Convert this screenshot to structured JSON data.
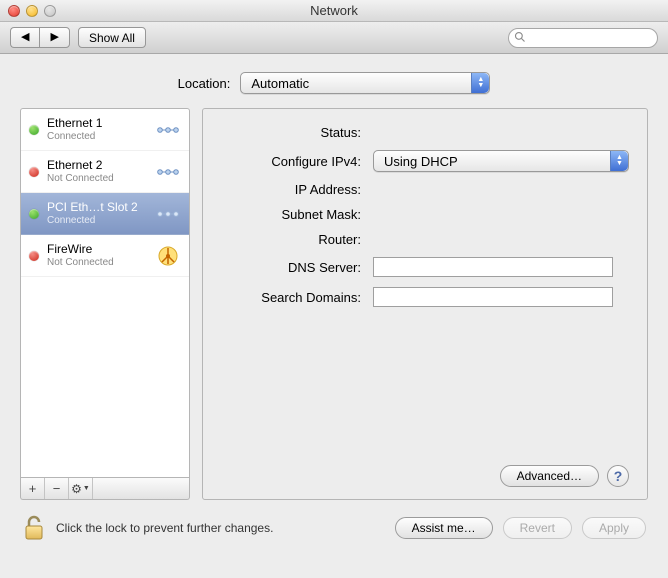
{
  "window": {
    "title": "Network"
  },
  "toolbar": {
    "show_all": "Show All",
    "search_placeholder": ""
  },
  "location": {
    "label": "Location:",
    "value": "Automatic"
  },
  "sidebar": {
    "items": [
      {
        "name": "Ethernet 1",
        "status": "Connected",
        "dot": "green",
        "kind": "ethernet",
        "selected": false
      },
      {
        "name": "Ethernet 2",
        "status": "Not Connected",
        "dot": "red",
        "kind": "ethernet",
        "selected": false
      },
      {
        "name": "PCI Eth…t Slot 2",
        "status": "Connected",
        "dot": "green",
        "kind": "ethernet",
        "selected": true
      },
      {
        "name": "FireWire",
        "status": "Not Connected",
        "dot": "red",
        "kind": "firewire",
        "selected": false
      }
    ],
    "footer": {
      "add": "+",
      "remove": "−",
      "gear": "⚙"
    }
  },
  "detail": {
    "labels": {
      "status": "Status:",
      "configure_ipv4": "Configure IPv4:",
      "ip_address": "IP Address:",
      "subnet_mask": "Subnet Mask:",
      "router": "Router:",
      "dns_server": "DNS Server:",
      "search_domains": "Search Domains:"
    },
    "values": {
      "status": "",
      "configure_ipv4": "Using DHCP",
      "ip_address": "",
      "subnet_mask": "",
      "router": "",
      "dns_server": "",
      "search_domains": ""
    },
    "buttons": {
      "advanced": "Advanced…",
      "help": "?"
    }
  },
  "bottom": {
    "lock_text": "Click the lock to prevent further changes.",
    "assist": "Assist me…",
    "revert": "Revert",
    "apply": "Apply"
  }
}
